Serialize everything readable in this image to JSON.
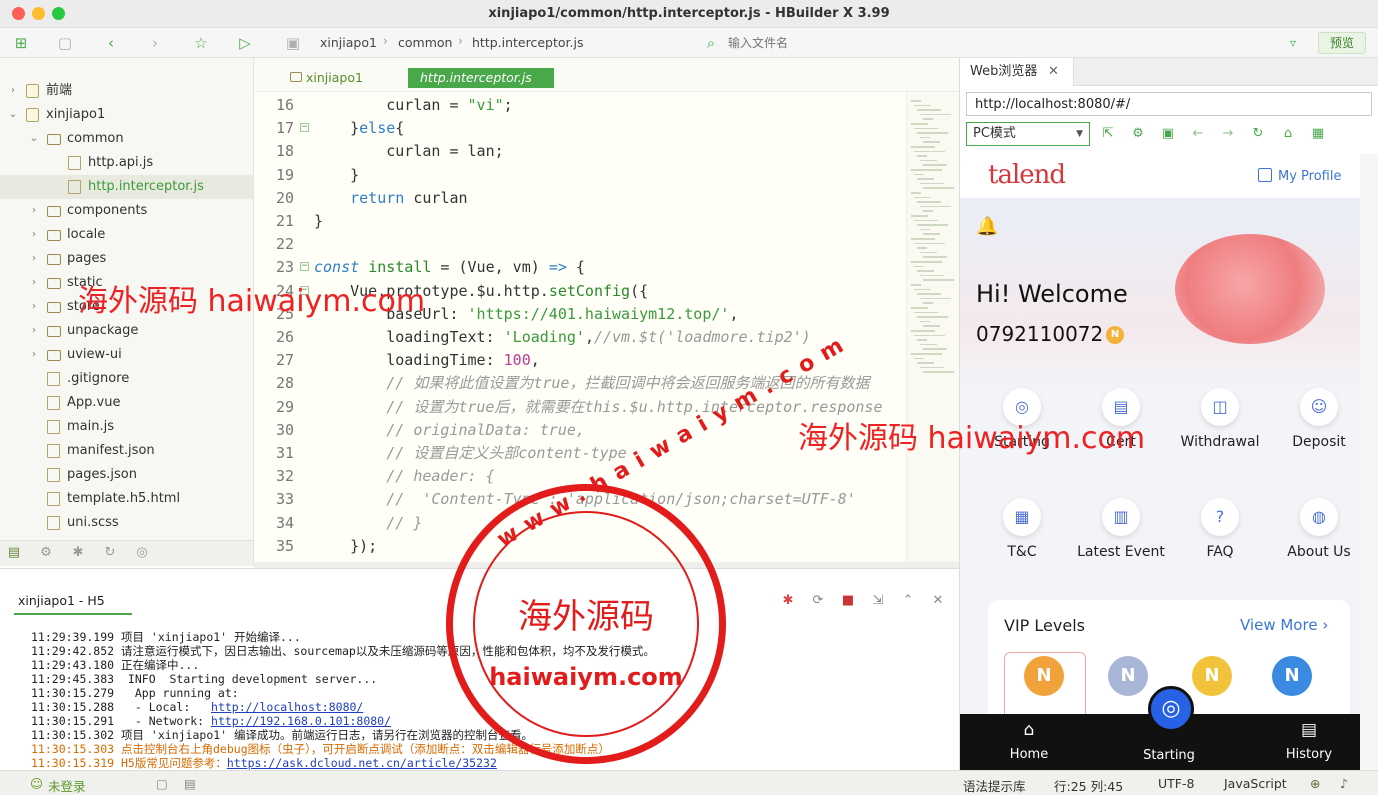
{
  "window": {
    "title": "xinjiapo1/common/http.interceptor.js - HBuilder X 3.99"
  },
  "toolbar": {
    "breadcrumb": [
      "xinjiapo1",
      "common",
      "http.interceptor.js"
    ],
    "file_search_placeholder": "输入文件名",
    "preview_label": "预览"
  },
  "sidebar": {
    "items": [
      {
        "label": "前端",
        "type": "project",
        "expanded": false
      },
      {
        "label": "xinjiapo1",
        "type": "project",
        "expanded": true
      },
      {
        "label": "common",
        "type": "folder",
        "expanded": true
      },
      {
        "label": "http.api.js",
        "type": "file"
      },
      {
        "label": "http.interceptor.js",
        "type": "file",
        "active": true
      },
      {
        "label": "components",
        "type": "folder"
      },
      {
        "label": "locale",
        "type": "folder"
      },
      {
        "label": "pages",
        "type": "folder"
      },
      {
        "label": "static",
        "type": "folder"
      },
      {
        "label": "store",
        "type": "folder"
      },
      {
        "label": "unpackage",
        "type": "folder"
      },
      {
        "label": "uview-ui",
        "type": "folder"
      },
      {
        "label": ".gitignore",
        "type": "file"
      },
      {
        "label": "App.vue",
        "type": "file"
      },
      {
        "label": "main.js",
        "type": "file"
      },
      {
        "label": "manifest.json",
        "type": "file"
      },
      {
        "label": "pages.json",
        "type": "file"
      },
      {
        "label": "template.h5.html",
        "type": "file"
      },
      {
        "label": "uni.scss",
        "type": "file"
      }
    ]
  },
  "editor": {
    "folder_tab": "xinjiapo1",
    "active_tab": "http.interceptor.js",
    "lines": [
      {
        "n": "16",
        "code": [
          [
            "",
            "        curlan = "
          ],
          [
            "str",
            "\"vi\""
          ],
          [
            "",
            ";"
          ]
        ]
      },
      {
        "n": "17",
        "fold": true,
        "code": [
          [
            "",
            "    }"
          ],
          [
            "kw",
            "else"
          ],
          [
            "",
            "{"
          ]
        ]
      },
      {
        "n": "18",
        "code": [
          [
            "",
            "        curlan = lan;"
          ]
        ]
      },
      {
        "n": "19",
        "code": [
          [
            "",
            "    }"
          ]
        ]
      },
      {
        "n": "20",
        "code": [
          [
            "",
            "    "
          ],
          [
            "kw",
            "return"
          ],
          [
            "",
            " curlan"
          ]
        ]
      },
      {
        "n": "21",
        "code": [
          [
            "",
            "}"
          ]
        ]
      },
      {
        "n": "22",
        "code": [
          [
            "",
            ""
          ]
        ]
      },
      {
        "n": "23",
        "fold": true,
        "code": [
          [
            "kwi",
            "const"
          ],
          [
            "",
            " "
          ],
          [
            "fn",
            "install"
          ],
          [
            "",
            " = (Vue, vm) "
          ],
          [
            "kw",
            "=>"
          ],
          [
            "",
            " {"
          ]
        ]
      },
      {
        "n": "24",
        "fold": true,
        "code": [
          [
            "",
            "    Vue.prototype.$u.http."
          ],
          [
            "fn",
            "setConfig"
          ],
          [
            "",
            "({"
          ]
        ]
      },
      {
        "n": "25",
        "code": [
          [
            "",
            "        baseUrl: "
          ],
          [
            "str",
            "'https://401.haiwaiym12.top/'"
          ],
          [
            "",
            ","
          ]
        ]
      },
      {
        "n": "26",
        "code": [
          [
            "",
            "        loadingText: "
          ],
          [
            "str",
            "'Loading'"
          ],
          [
            "",
            ","
          ],
          [
            "cm",
            "//vm.$t('loadmore.tip2')"
          ]
        ]
      },
      {
        "n": "27",
        "code": [
          [
            "",
            "        loadingTime: "
          ],
          [
            "num",
            "100"
          ],
          [
            "",
            ","
          ]
        ]
      },
      {
        "n": "28",
        "code": [
          [
            "cm",
            "        // 如果将此值设置为true，拦截回调中将会返回服务端返回的所有数据"
          ]
        ]
      },
      {
        "n": "29",
        "code": [
          [
            "cm",
            "        // 设置为true后，就需要在this.$u.http.interceptor.response"
          ]
        ]
      },
      {
        "n": "30",
        "code": [
          [
            "cm",
            "        // originalData: true,"
          ]
        ]
      },
      {
        "n": "31",
        "code": [
          [
            "cm",
            "        // 设置自定义头部content-type"
          ]
        ]
      },
      {
        "n": "32",
        "code": [
          [
            "cm",
            "        // header: {"
          ]
        ]
      },
      {
        "n": "33",
        "code": [
          [
            "cm",
            "        //  'Content-Type': 'application/json;charset=UTF-8'"
          ]
        ]
      },
      {
        "n": "34",
        "code": [
          [
            "cm",
            "        // }"
          ]
        ]
      },
      {
        "n": "35",
        "code": [
          [
            "",
            "    });"
          ]
        ]
      }
    ]
  },
  "console": {
    "tab_label": "xinjiapo1 - H5",
    "lines": [
      {
        "text": "11:29:39.199 项目 'xinjiapo1' 开始编译..."
      },
      {
        "text": "11:29:42.852 请注意运行模式下，因日志输出、sourcemap以及未压缩源码等原因，性能和包体积，均不及发行模式。"
      },
      {
        "text": "11:29:43.180 正在编译中..."
      },
      {
        "text": "11:29:45.383  INFO  Starting development server..."
      },
      {
        "text": "11:30:15.279   App running at:"
      },
      {
        "text": "11:30:15.288   - Local:   ",
        "link": "http://localhost:8080/"
      },
      {
        "text": "11:30:15.291   - Network: ",
        "link": "http://192.168.0.101:8080/"
      },
      {
        "text": "11:30:15.302 项目 'xinjiapo1' 编译成功。前端运行日志，请另行在浏览器的控制台查看。"
      },
      {
        "text": "11:30:15.303 点击控制台右上角debug图标（虫子），可开启断点调试（添加断点：双击编辑器行号添加断点）",
        "orange": true
      },
      {
        "text": "11:30:15.319 H5版常见问题参考：",
        "link": "https://ask.dcloud.net.cn/article/35232",
        "orange": true
      }
    ]
  },
  "statusbar": {
    "login": "未登录",
    "hint": "语法提示库",
    "position": "行:25  列:45",
    "encoding": "UTF-8",
    "language": "JavaScript"
  },
  "browser": {
    "tab_title": "Web浏览器",
    "url": "http://localhost:8080/#/",
    "mode": "PC模式",
    "app": {
      "logo": "talend",
      "my_profile": "My Profile",
      "welcome": "Hi! Welcome",
      "phone": "0792110072",
      "badge_letter": "N",
      "menu": [
        {
          "label": "Starting",
          "icon": "target-icon"
        },
        {
          "label": "Cert",
          "icon": "certificate-icon"
        },
        {
          "label": "Withdrawal",
          "icon": "wallet-icon"
        },
        {
          "label": "Deposit",
          "icon": "user-icon"
        },
        {
          "label": "T&C",
          "icon": "document-icon"
        },
        {
          "label": "Latest Event",
          "icon": "calendar-icon"
        },
        {
          "label": "FAQ",
          "icon": "help-icon"
        },
        {
          "label": "About Us",
          "icon": "globe-icon"
        }
      ],
      "vip": {
        "title": "VIP Levels",
        "more": "View More"
      },
      "tabs": [
        {
          "label": "Home",
          "icon": "home-icon"
        },
        {
          "label": "Starting",
          "icon": "target-icon"
        },
        {
          "label": "History",
          "icon": "history-icon"
        }
      ]
    }
  },
  "watermark": {
    "text_1": "海外源码 haiwaiym.com",
    "text_2": "海外源码 haiwaiym.com",
    "stamp_top": "www.haiwaiym.com",
    "stamp_main": "海外源码",
    "stamp_sub": "haiwaiym.com"
  },
  "colors": {
    "accent": "#49a84a",
    "link": "#3b74d6",
    "watermark": "#e22222"
  }
}
